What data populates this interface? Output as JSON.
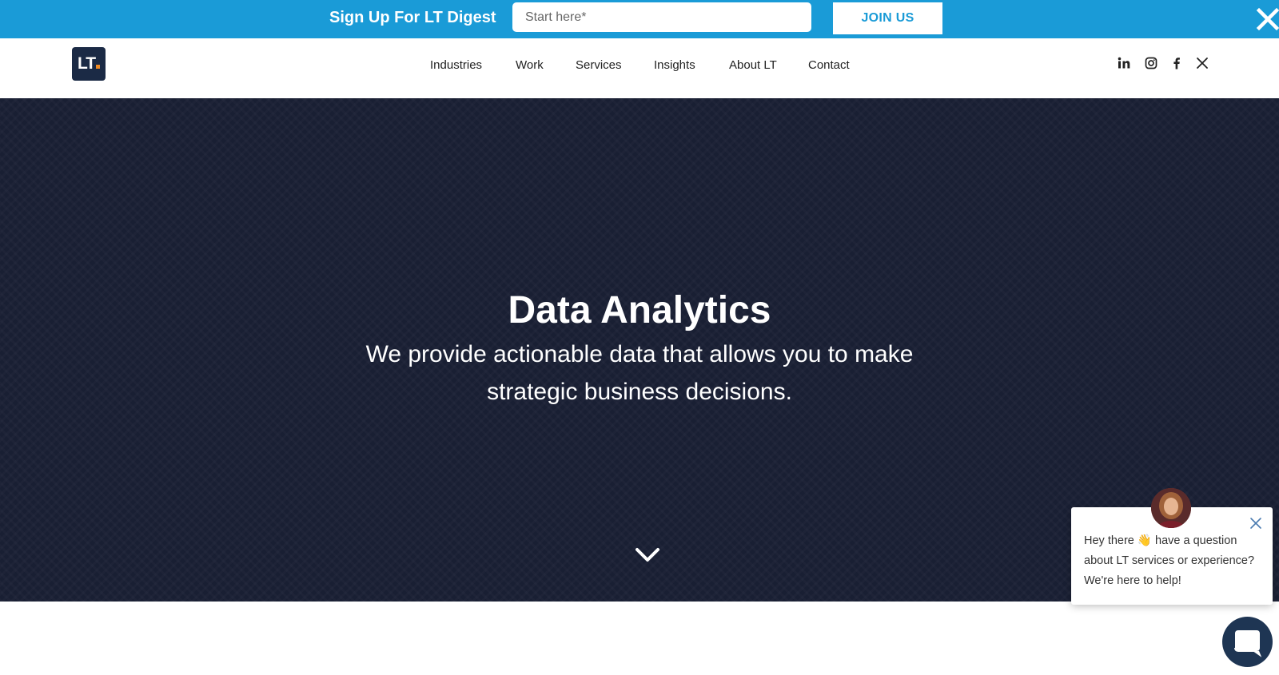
{
  "promo": {
    "title": "Sign Up For LT Digest",
    "input_placeholder": "Start here*",
    "join_label": "JOIN US",
    "close_icon": "close-icon"
  },
  "header": {
    "logo_text": "LT",
    "nav": [
      "Industries",
      "Work",
      "Services",
      "Insights",
      "About LT",
      "Contact"
    ],
    "social_icons": [
      "linkedin-icon",
      "instagram-icon",
      "facebook-icon",
      "x-icon"
    ]
  },
  "hero": {
    "title": "Data Analytics",
    "subtitle": "We provide actionable data that allows you to make strategic business decisions.",
    "scroll_icon": "chevron-down-icon"
  },
  "chat": {
    "message_part1": "Hey there",
    "wave_emoji": "👋",
    "message_part2": "have a question about LT services or experience? We're here to help!"
  },
  "colors": {
    "promo_bg": "#1a9bd7",
    "hero_bg": "#191f33",
    "logo_bg": "#1b2a45",
    "logo_dot": "#f08a24",
    "chat_launcher": "#1e3553"
  }
}
